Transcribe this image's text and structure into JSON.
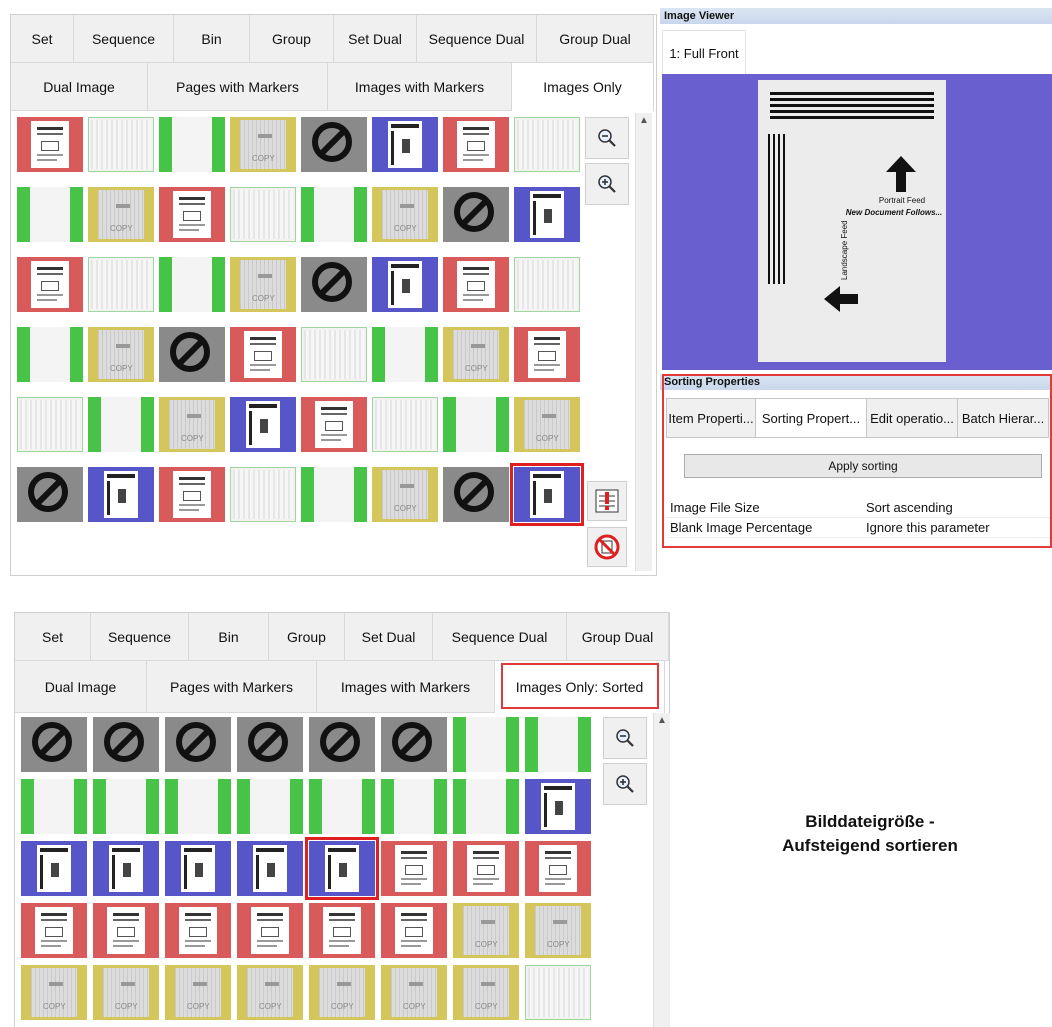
{
  "top": {
    "tabs_row1": [
      "Set",
      "Sequence",
      "Bin",
      "Group",
      "Set Dual",
      "Sequence Dual",
      "Group Dual"
    ],
    "tabs_row2": [
      "Dual Image",
      "Pages with Markers",
      "Images with Markers",
      "Images Only"
    ],
    "active_tab": "Images Only"
  },
  "viewer": {
    "title": "Image Viewer",
    "tab": "1: Full Front",
    "page_text": {
      "portrait": "Portrait Feed",
      "new_doc": "New Document Follows...",
      "landscape": "Landscape Feed"
    }
  },
  "sorting": {
    "title": "Sorting Properties",
    "tabs": [
      "Item Properti...",
      "Sorting Propert...",
      "Edit operatio...",
      "Batch Hierar..."
    ],
    "apply_label": "Apply sorting",
    "rows": [
      {
        "key": "Image File Size",
        "value": "Sort ascending"
      },
      {
        "key": "Blank Image Percentage",
        "value": "Ignore this parameter"
      }
    ]
  },
  "bottom": {
    "tabs_row1": [
      "Set",
      "Sequence",
      "Bin",
      "Group",
      "Set Dual",
      "Sequence Dual",
      "Group Dual"
    ],
    "tabs_row2": [
      "Dual Image",
      "Pages with Markers",
      "Images with Markers",
      "Images Only: Sorted"
    ]
  },
  "caption": {
    "line1": "Bilddateigröße -",
    "line2": "Aufsteigend sortieren"
  },
  "icons": {
    "zoom_out": "zoom-out-icon",
    "zoom_in": "zoom-in-icon",
    "mark": "marker-icon",
    "clear": "clear-marker-icon"
  },
  "colors": {
    "red": "#d95a5a",
    "green": "#47c447",
    "blue": "#5656c9",
    "yellow": "#d4c65a",
    "gray": "#8a8a8a",
    "viewer_bg": "#6a5fcf",
    "highlight": "#e02020"
  },
  "top_grid": [
    [
      "red",
      "faint",
      "green",
      "yellow",
      "gray",
      "blue",
      "red",
      "faint"
    ],
    [
      "green",
      "yellow",
      "red",
      "faint",
      "green",
      "yellow",
      "gray",
      "blue"
    ],
    [
      "red",
      "faint",
      "green",
      "yellow",
      "gray",
      "blue",
      "red",
      "faint"
    ],
    [
      "green",
      "yellow",
      "gray",
      "red",
      "faint",
      "green",
      "yellow",
      "red"
    ],
    [
      "faint",
      "green",
      "yellow",
      "blue",
      "red",
      "faint",
      "green",
      "yellow"
    ],
    [
      "gray",
      "blue",
      "red",
      "faint",
      "green",
      "yellow",
      "gray",
      "blue"
    ]
  ],
  "bottom_grid": [
    [
      "gray",
      "gray",
      "gray",
      "gray",
      "gray",
      "gray",
      "green",
      "green"
    ],
    [
      "green",
      "green",
      "green",
      "green",
      "green",
      "green",
      "green",
      "blue"
    ],
    [
      "blue",
      "blue",
      "blue",
      "blue",
      "blue",
      "red",
      "red",
      "red"
    ],
    [
      "red",
      "red",
      "red",
      "red",
      "red",
      "red",
      "yellow",
      "yellow"
    ],
    [
      "yellow",
      "yellow",
      "yellow",
      "yellow",
      "yellow",
      "yellow",
      "yellow",
      "faint"
    ]
  ]
}
